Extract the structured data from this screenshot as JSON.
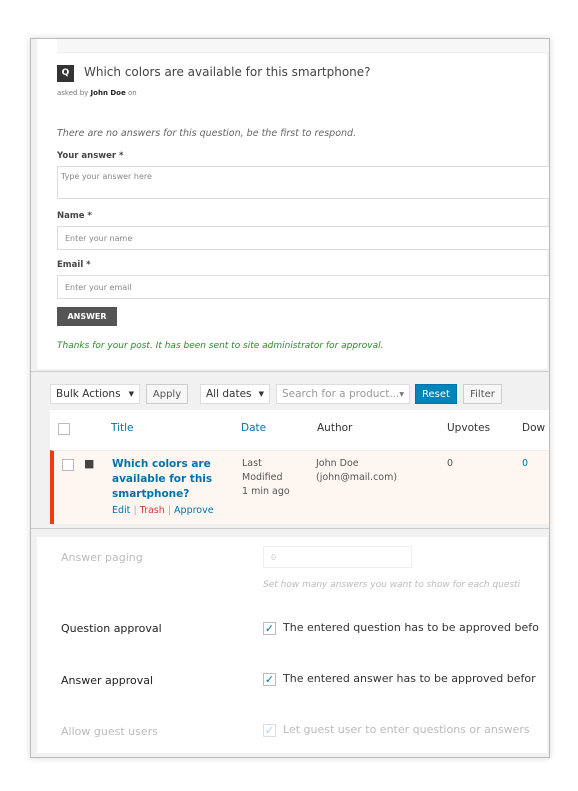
{
  "question": {
    "badge": "Q",
    "title": "Which colors are available for this smartphone?",
    "asked_prefix": "asked by",
    "author": "John Doe",
    "asked_suffix": "on",
    "no_answers": "There are no answers for this question, be the first to respond.",
    "answer_label": "Your answer *",
    "answer_placeholder": "Type your answer here",
    "name_label": "Name *",
    "name_placeholder": "Enter your name",
    "email_label": "Email *",
    "email_placeholder": "Enter your email",
    "submit": "ANSWER",
    "thanks": "Thanks for your post. It has been sent to site administrator for approval."
  },
  "toolbar": {
    "bulk": "Bulk Actions",
    "apply": "Apply",
    "dates": "All dates",
    "search_placeholder": "Search for a product...",
    "reset": "Reset",
    "filter": "Filter"
  },
  "table": {
    "headers": [
      "Title",
      "Date",
      "Author",
      "Upvotes",
      "Dow"
    ],
    "rows": [
      {
        "title": "Which colors are available for this smartphone?",
        "date": [
          "Last",
          "Modified",
          "1 min ago"
        ],
        "author": [
          "John Doe",
          "(john@mail.com)"
        ],
        "upvotes": "0",
        "downvotes": "0",
        "actions": {
          "edit": "Edit",
          "trash": "Trash",
          "approve": "Approve"
        }
      }
    ]
  },
  "settings": {
    "paging_label": "Answer paging",
    "paging_value": "0",
    "paging_hint": "Set how many answers you want to show for each questi",
    "qa_label": "Question approval",
    "qa_text": "The entered question has to be approved befo",
    "qa_checked": true,
    "aa_label": "Answer approval",
    "aa_text": "The entered answer has to be approved befor",
    "aa_checked": true,
    "guest_label": "Allow guest users",
    "guest_text": "Let guest user to enter questions or answers",
    "guest_checked": true
  },
  "colors": {
    "accent": "#0073aa",
    "primary_button": "#0085ba",
    "unapproved_border": "#f23a0f",
    "success": "#2a8a2a"
  }
}
